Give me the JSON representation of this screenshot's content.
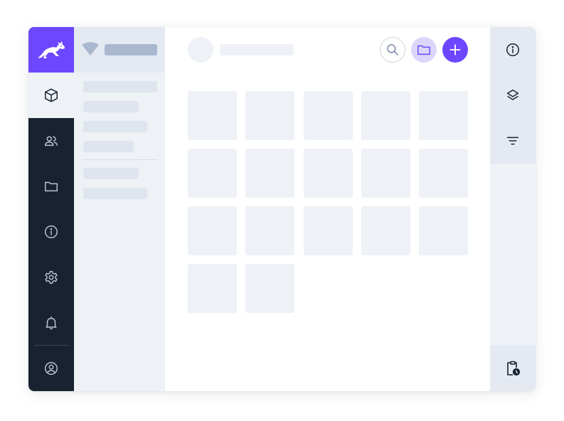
{
  "colors": {
    "accent": "#6c47ff",
    "rail": "#182230",
    "panel": "#eef1f6",
    "panel_header": "#e4e9f2",
    "skeleton": "#dfe5ee"
  },
  "left_rail": {
    "brand_icon": "rabbit-logo-icon",
    "items": [
      {
        "icon": "cube-icon",
        "active": true
      },
      {
        "icon": "users-icon",
        "active": false
      },
      {
        "icon": "folder-icon",
        "active": false
      },
      {
        "icon": "info-icon",
        "active": false
      },
      {
        "icon": "gear-icon",
        "active": false
      },
      {
        "icon": "bell-icon",
        "active": false
      },
      {
        "icon": "user-circle-icon",
        "active": false
      }
    ]
  },
  "panel": {
    "header_icon": "wifi-icon"
  },
  "main": {
    "toolbar": {
      "search_icon": "search-icon",
      "folder_icon": "folder-icon",
      "add_icon": "plus-icon"
    },
    "tile_count": 17
  },
  "right_rail": {
    "items": [
      {
        "icon": "info-icon"
      },
      {
        "icon": "layers-icon"
      },
      {
        "icon": "filter-icon"
      },
      {
        "icon": "clipboard-clock-icon"
      }
    ]
  }
}
